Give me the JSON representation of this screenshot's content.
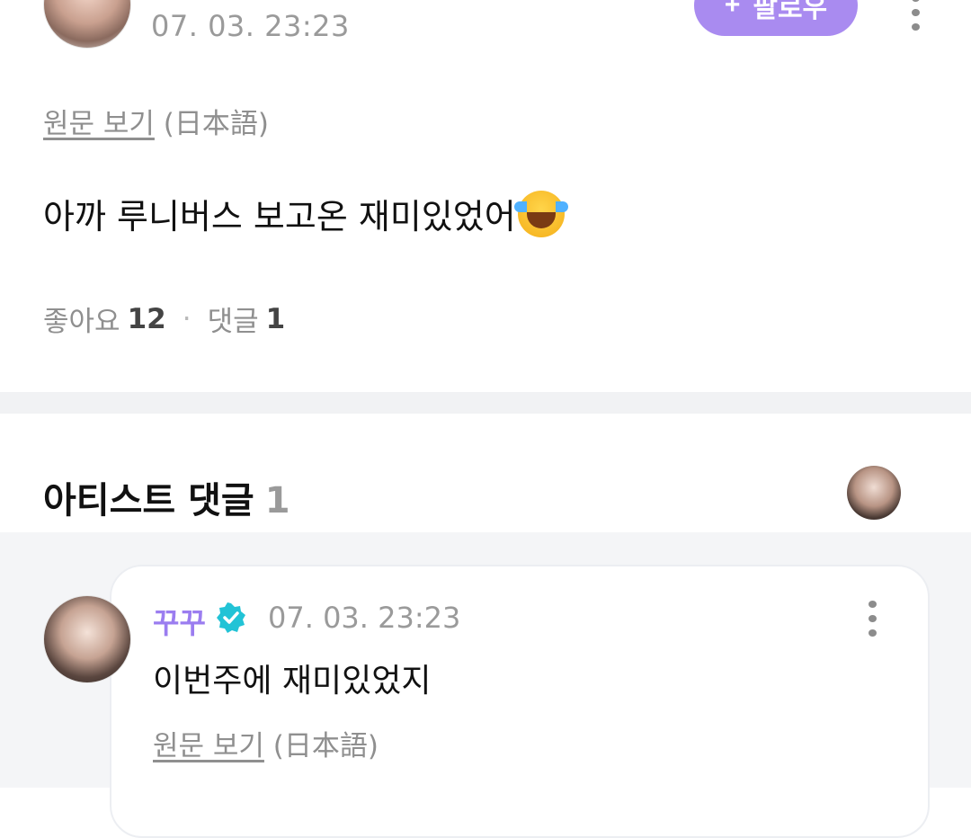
{
  "post": {
    "date": "07. 03. 23:23",
    "follow_label": "팔로우",
    "follow_plus": "+",
    "translate_link": "원문 보기",
    "translate_lang": "(日本語)",
    "body": "아까 루니버스 보고온 재미있었어",
    "emoji": "face-with-tears-of-joy-icon",
    "likes_label": "좋아요",
    "likes_count": "12",
    "separator": "·",
    "comments_label": "댓글",
    "comments_count": "1"
  },
  "artist_comments": {
    "title": "아티스트 댓글",
    "count": "1",
    "items": [
      {
        "name": "꾸꾸",
        "verified": true,
        "date": "07. 03. 23:23",
        "body": "이번주에 재미있었지",
        "translate_link": "원문 보기",
        "translate_lang": "(日本語)"
      }
    ]
  },
  "colors": {
    "accent": "#a98bf0",
    "name": "#9b7df0",
    "verified": "#22c3d6",
    "muted": "#9a9a9a"
  }
}
